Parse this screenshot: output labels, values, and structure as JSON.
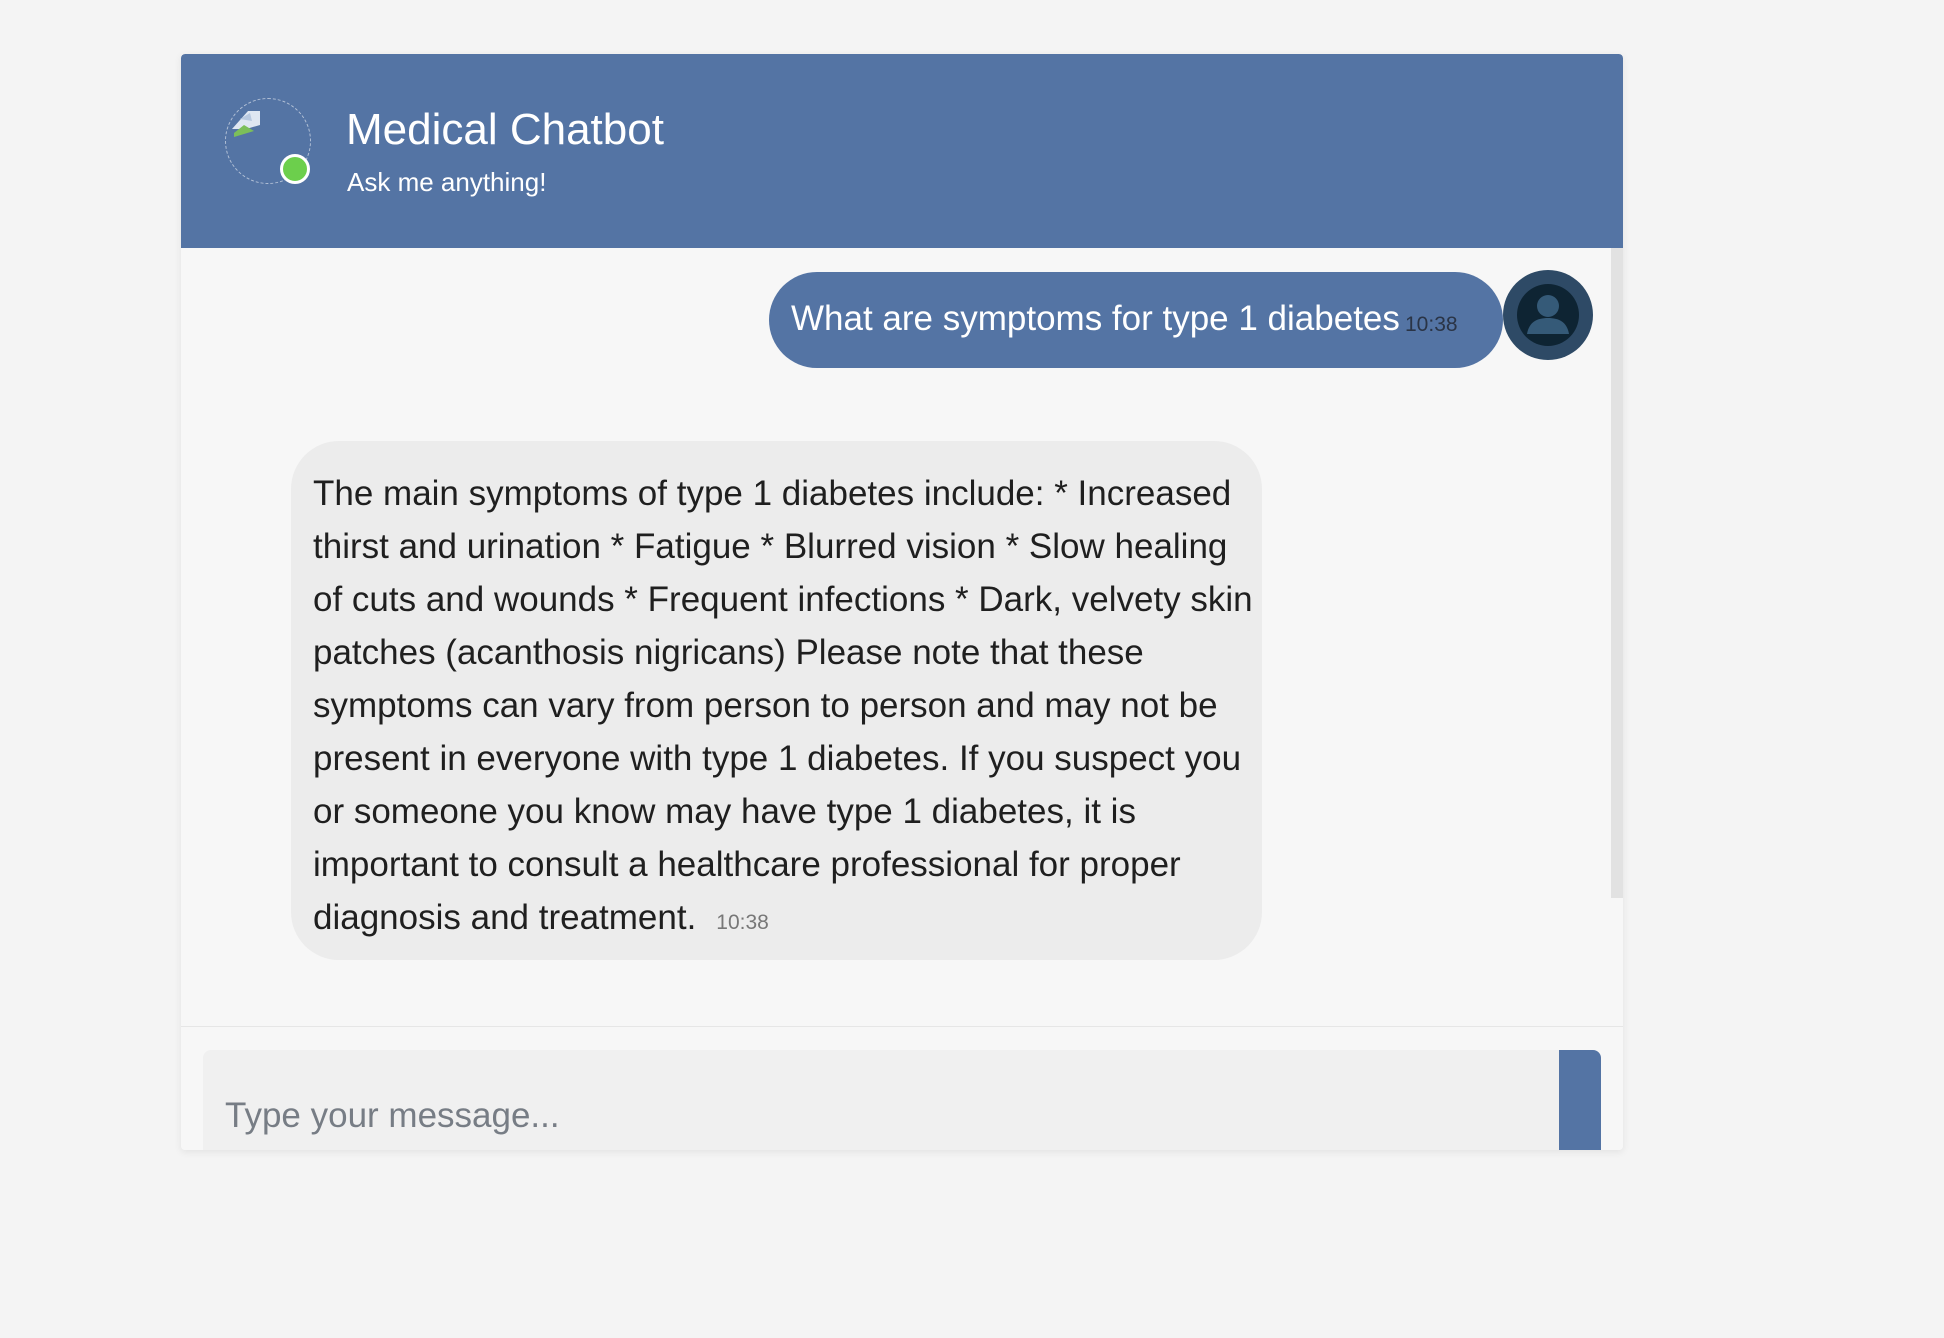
{
  "header": {
    "title": "Medical Chatbot",
    "subtitle": "Ask me anything!",
    "bot_avatar_icon": "broken-image-icon",
    "status": "online",
    "status_color": "#6ccf4c",
    "accent_color": "#5474a4"
  },
  "messages": [
    {
      "sender": "user",
      "text": "What are symptoms for type 1 diabetes",
      "time": "10:38",
      "avatar_icon": "user-circle-icon"
    },
    {
      "sender": "bot",
      "text": "The main symptoms of type 1 diabetes include: * Increased thirst and urination * Fatigue * Blurred vision * Slow healing of cuts and wounds * Frequent infections * Dark, velvety skin patches (acanthosis nigricans) Please note that these symptoms can vary from person to person and may not be present in everyone with type 1 diabetes. If you suspect you or someone you know may have type 1 diabetes, it is important to consult a healthcare professional for proper diagnosis and treatment.",
      "time": "10:38"
    }
  ],
  "composer": {
    "placeholder": "Type your message...",
    "value": ""
  }
}
